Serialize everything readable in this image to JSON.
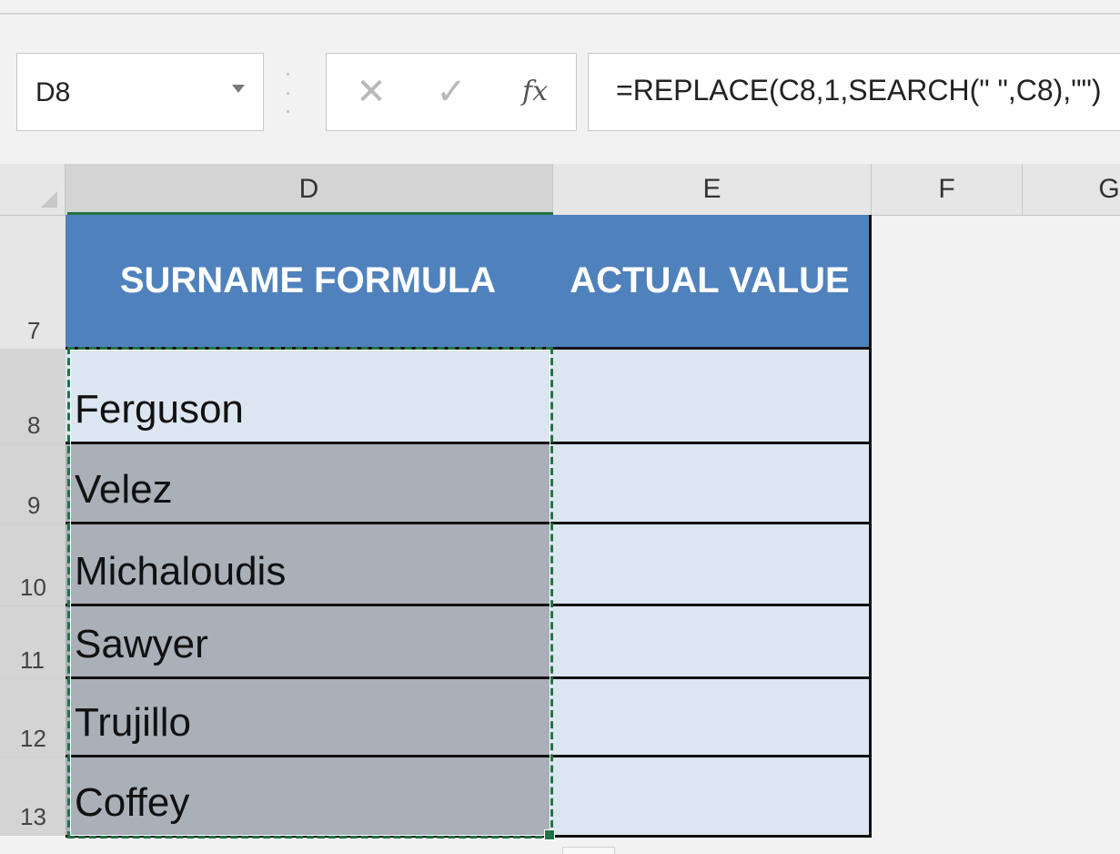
{
  "formula_bar": {
    "name_box": "D8",
    "cancel_icon": "✕",
    "enter_icon": "✓",
    "fx_label": "fx",
    "formula": "=REPLACE(C8,1,SEARCH(\" \",C8),\"\")"
  },
  "columns": [
    "D",
    "E",
    "F",
    "G"
  ],
  "rows": [
    "7",
    "8",
    "9",
    "10",
    "11",
    "12",
    "13"
  ],
  "table": {
    "headers": [
      "SURNAME FORMULA",
      "ACTUAL VALUE"
    ],
    "surnames": [
      "Ferguson",
      "Velez",
      "Michaloudis",
      "Sawyer",
      "Trujillo",
      "Coffey"
    ]
  },
  "colors": {
    "header_fill": "#4f81bd",
    "selected_fill": "#dce6f1",
    "data_fill": "#a9b0b8",
    "selection_border": "#217346"
  }
}
